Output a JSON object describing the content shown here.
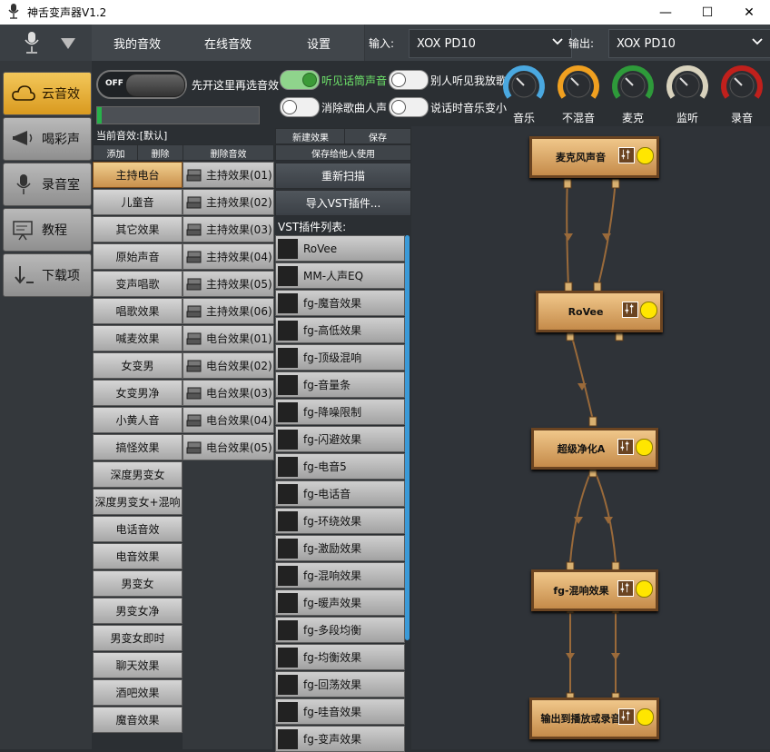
{
  "window": {
    "title": "神舌变声器V1.2",
    "minimize": "—",
    "maximize": "☐",
    "close": "✕"
  },
  "top_tabs": [
    "我的音效",
    "在线音效",
    "设置"
  ],
  "input": {
    "label": "输入:",
    "value": "XOX PD10"
  },
  "output": {
    "label": "输出:",
    "value": "XOX PD10"
  },
  "nav": [
    {
      "label": "云音效",
      "icon": "cloud-icon",
      "active": true
    },
    {
      "label": "喝彩声",
      "icon": "cheer-icon",
      "active": false
    },
    {
      "label": "录音室",
      "icon": "microphone-icon",
      "active": false
    },
    {
      "label": "教程",
      "icon": "tutorial-icon",
      "active": false
    },
    {
      "label": "下载项",
      "icon": "download-icon",
      "active": false
    }
  ],
  "master_toggle": {
    "state": "OFF",
    "label": "先开这里再选音效"
  },
  "toggles": [
    {
      "label": "听见话筒声音",
      "on": true
    },
    {
      "label": "别人听见我放歌",
      "on": false
    },
    {
      "label": "消除歌曲人声",
      "on": false
    },
    {
      "label": "说话时音乐变小",
      "on": false
    }
  ],
  "dials": [
    {
      "label": "音乐",
      "color": "#4aa8e0"
    },
    {
      "label": "不混音",
      "color": "#f0a020"
    },
    {
      "label": "麦克",
      "color": "#2e9a3a"
    },
    {
      "label": "监听",
      "color": "#d8d2bd"
    },
    {
      "label": "录音",
      "color": "#c0201c"
    }
  ],
  "current_effect_label": "当前音效:[默认]",
  "effect_buttons": {
    "add": "添加",
    "delete": "删除",
    "delete_effect": "删除音效",
    "new_effect": "新建效果",
    "save": "保存",
    "save_for_others": "保存给他人使用"
  },
  "effects": [
    "主持电台",
    "儿童音",
    "其它效果",
    "原始声音",
    "变声唱歌",
    "唱歌效果",
    "喊麦效果",
    "女变男",
    "女变男净",
    "小黄人音",
    "搞怪效果",
    "深度男变女",
    "深度男变女+混响",
    "电话音效",
    "电音效果",
    "男变女",
    "男变女净",
    "男变女即时",
    "聊天效果",
    "酒吧效果",
    "魔音效果"
  ],
  "selected_effect": 0,
  "sub_effects": [
    "主持效果(01)",
    "主持效果(02)",
    "主持效果(03)",
    "主持效果(04)",
    "主持效果(05)",
    "主持效果(06)",
    "电台效果(01)",
    "电台效果(02)",
    "电台效果(03)",
    "电台效果(04)",
    "电台效果(05)"
  ],
  "rescan": "重新扫描",
  "import_vst": "导入VST插件...",
  "vst_list_label": "VST插件列表:",
  "vst_plugins": [
    "RoVee",
    "MM-人声EQ",
    "fg-魔音效果",
    "fg-高低效果",
    "fg-顶级混响",
    "fg-音量条",
    "fg-降噪限制",
    "fg-闪避效果",
    "fg-电音5",
    "fg-电话音",
    "fg-环绕效果",
    "fg-激励效果",
    "fg-混响效果",
    "fg-暖声效果",
    "fg-多段均衡",
    "fg-均衡效果",
    "fg-回荡效果",
    "fg-哇音效果",
    "fg-变声效果"
  ],
  "nodes": [
    "麦克风声音",
    "RoVee",
    "超级净化A",
    "fg-混响效果",
    "输出到播放或录音"
  ]
}
